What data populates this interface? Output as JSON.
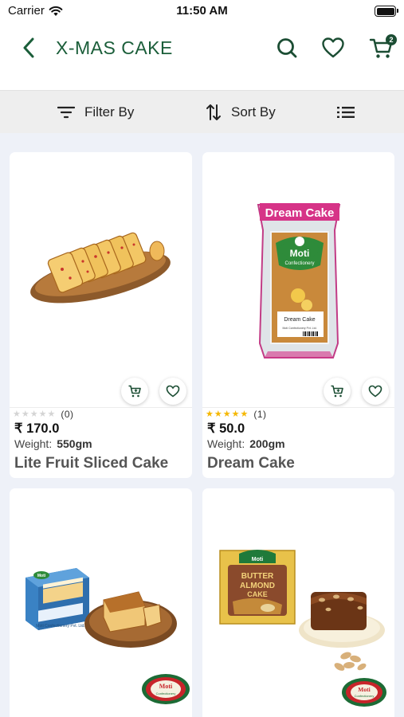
{
  "status_bar": {
    "carrier": "Carrier",
    "time": "11:50 AM"
  },
  "header": {
    "title": "X-MAS CAKE",
    "cart_count": "2",
    "icons": [
      "chevron-left-icon",
      "search-icon",
      "heart-icon",
      "cart-icon"
    ],
    "accent_color": "#1b5e3a"
  },
  "toolbar": {
    "filter_label": "Filter By",
    "sort_label": "Sort By",
    "icons": [
      "filter-icon",
      "sort-icon",
      "list-view-icon"
    ]
  },
  "products": [
    {
      "name": "Lite Fruit Sliced Cake",
      "price": "₹ 170.0",
      "weight_label": "Weight:",
      "weight": "550gm",
      "rating": 0,
      "rating_count": "(0)"
    },
    {
      "name": "Dream Cake",
      "price": "₹ 50.0",
      "weight_label": "Weight:",
      "weight": "200gm",
      "rating": 5,
      "rating_count": "(1)",
      "package_texts": [
        "Dream Cake",
        "Moti",
        "Confectionery",
        "Dream Cake",
        "Moti Confectionery Pvt. Ltd."
      ]
    },
    {
      "package_texts": [
        "Moti",
        "Moti Confectionery Pvt. Ltd.",
        "Moti",
        "Confectionery"
      ]
    },
    {
      "package_texts": [
        "Moti",
        "BUTTER",
        "ALMOND",
        "CAKE",
        "Moti",
        "Confectionery"
      ]
    }
  ],
  "colors": {
    "star_filled": "#f5b700",
    "star_empty": "#d4d4d4",
    "grid_background": "#eef1f8",
    "toolbar_background": "#eeeeee"
  }
}
